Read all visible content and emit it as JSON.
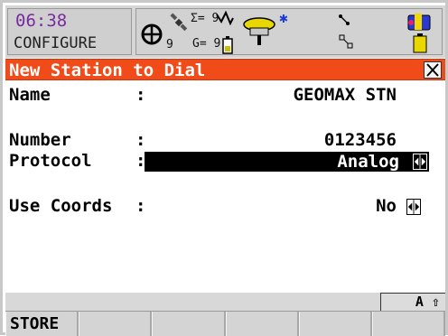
{
  "status": {
    "time": "06:38",
    "mode": "CONFIGURE",
    "sat_count": "9",
    "sigma_label": "Σ= 9",
    "g_label": "G= 9"
  },
  "title_bar": {
    "title": "New Station to Dial",
    "close_icon": "close-icon"
  },
  "fields": {
    "name": {
      "label": "Name",
      "colon": ":",
      "value": "GEOMAX STN"
    },
    "number": {
      "label": "Number",
      "colon": ":",
      "value": "0123456"
    },
    "protocol": {
      "label": "Protocol",
      "colon": ":",
      "value": "Analog"
    },
    "use_coords": {
      "label": "Use Coords",
      "colon": ":",
      "value": "No"
    }
  },
  "input_mode": "A ⇧",
  "softkeys": [
    "STORE",
    "",
    "",
    "",
    "",
    ""
  ],
  "colors": {
    "title_bg": "#f24b1a",
    "time": "#7a2aa0",
    "selected_bg": "#000000"
  }
}
